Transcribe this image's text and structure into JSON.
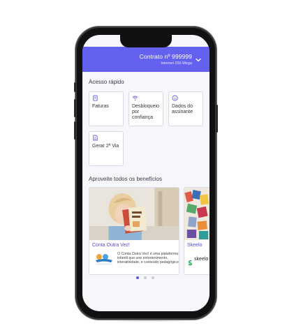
{
  "header": {
    "contract": "Contrato nº 999999",
    "plan": "Internet 250 Mega"
  },
  "quick_access": {
    "title": "Acesso rápido",
    "items": [
      {
        "label": "Faturas",
        "icon": "invoice-icon"
      },
      {
        "label": "Desbloqueio por confiança",
        "icon": "wifi-unlock-icon"
      },
      {
        "label": "Dados do assinante",
        "icon": "user-smile-icon"
      },
      {
        "label": "Gerar 2ª Via",
        "icon": "document-icon"
      }
    ]
  },
  "benefits": {
    "title": "Aproveite todos os benefícios",
    "cards": [
      {
        "title": "Conta Outra Vez!",
        "logo_text": "Conta Outra Vez",
        "description": "O Conta Outra Vez! é uma plataforma infantil que une entretenimento, interatividade, e conteúdo pedagógico."
      },
      {
        "title": "Skeelo",
        "logo_text": "skeelo"
      }
    ],
    "pagination": {
      "count": 3,
      "active": 1
    }
  },
  "colors": {
    "accent": "#6561f0",
    "dot_active": "#5c58e6",
    "dot_inactive": "#c9c9d6"
  }
}
